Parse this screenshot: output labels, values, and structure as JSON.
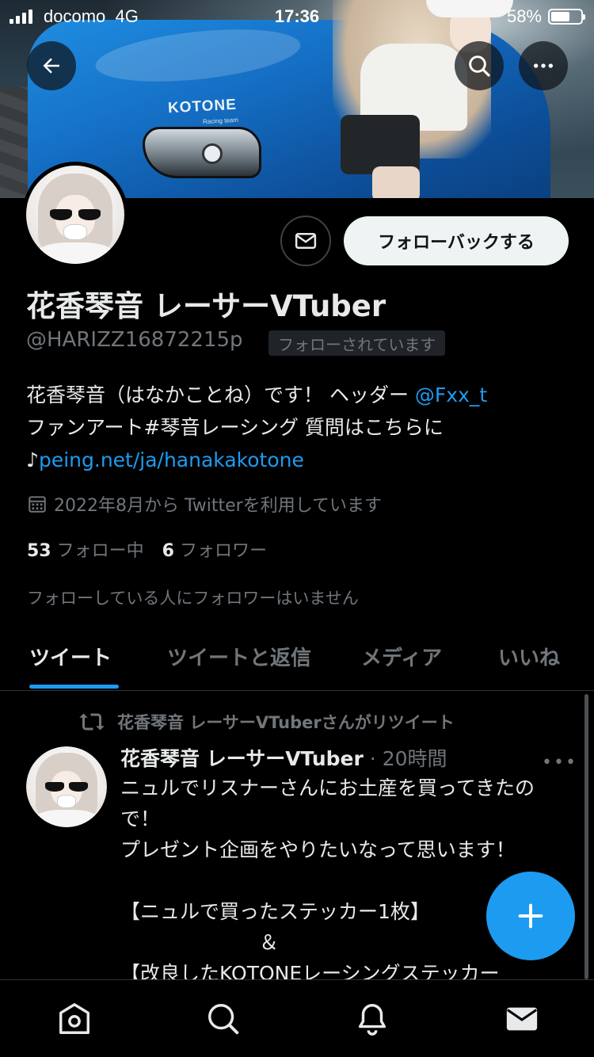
{
  "status_bar": {
    "carrier": "docomo",
    "network": "4G",
    "time": "17:36",
    "battery": "58%"
  },
  "banner": {
    "logo_text": "KOTONE",
    "logo_sub": "Racing team"
  },
  "profile": {
    "follow_back_label": "フォローバックする",
    "name": "花香琴音 レーサーVTuber",
    "handle": "@HARIZZ16872215p",
    "follows_you_badge": "フォローされています",
    "bio_line1": "花香琴音（はなかことね）です！ ヘッダー ",
    "bio_mention": "@Fxx_t",
    "bio_line2": "ファンアート#琴音レーシング 質問はこちらに",
    "bio_line3_prefix": "♪",
    "bio_link": "peing.net/ja/hanakakotone",
    "joined": "2022年8月から Twitterを利用しています",
    "following_count": "53",
    "following_label": "フォロー中",
    "followers_count": "6",
    "followers_label": "フォロワー",
    "no_known_followers": "フォローしている人にフォロワーはいません"
  },
  "tabs": [
    {
      "label": "ツイート",
      "active": true
    },
    {
      "label": "ツイートと返信",
      "active": false
    },
    {
      "label": "メディア",
      "active": false
    },
    {
      "label": "いいね",
      "active": false
    }
  ],
  "tweet": {
    "retweet_label": "花香琴音 レーサーVTuberさんがリツイート",
    "author": "花香琴音 レーサーVTuber",
    "time": "· 20時間",
    "more": "•••",
    "body": "ニュルでリスナーさんにお土産を買ってきたので！\nプレゼント企画をやりたいなって思います！\n\n【ニュルで買ったステッカー1枚】\n　　　　　　　＆\n【改良したKOTONEレーシングステッカー"
  },
  "icons": {
    "back": "arrow-left-icon",
    "search": "search-icon",
    "more": "more-icon",
    "message": "envelope-icon",
    "calendar": "calendar-icon",
    "retweet": "retweet-icon",
    "compose": "plus-icon",
    "home": "home-icon",
    "explore": "search-icon",
    "notifications": "bell-icon",
    "messages": "envelope-icon"
  },
  "colors": {
    "accent": "#1d9bf0",
    "background": "#000000",
    "secondary_text": "#71767b"
  }
}
